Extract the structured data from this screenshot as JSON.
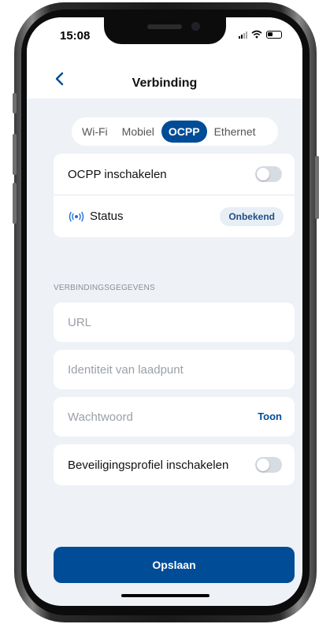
{
  "status_bar": {
    "time": "15:08"
  },
  "header": {
    "title": "Verbinding",
    "back_icon": "chevron-left-icon"
  },
  "tabs": [
    {
      "label": "Wi-Fi",
      "active": false
    },
    {
      "label": "Mobiel",
      "active": false
    },
    {
      "label": "OCPP",
      "active": true
    },
    {
      "label": "Ethernet",
      "active": false
    }
  ],
  "ocpp_card": {
    "toggle_label": "OCPP inschakelen",
    "toggle_on": false,
    "status_label": "Status",
    "status_icon": "broadcast-icon",
    "status_value": "Onbekend"
  },
  "section": {
    "title": "VERBINDINGSGEGEVENS"
  },
  "fields": {
    "url_placeholder": "URL",
    "identity_placeholder": "Identiteit van laadpunt",
    "password_placeholder": "Wachtwoord",
    "password_show_label": "Toon"
  },
  "security": {
    "label": "Beveiligingsprofiel inschakelen",
    "toggle_on": false
  },
  "save_button": {
    "label": "Opslaan"
  },
  "colors": {
    "accent": "#004c97",
    "background": "#eef1f6"
  }
}
